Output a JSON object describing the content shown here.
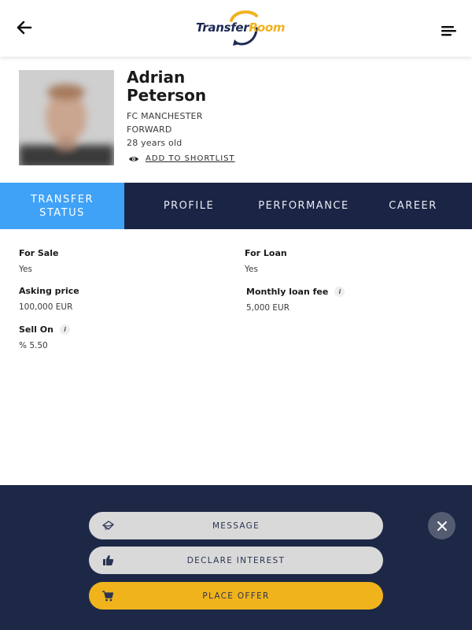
{
  "header": {
    "logo_part1": "Transfer",
    "logo_part2": "Room",
    "icons": {
      "back": "arrow-left-icon",
      "menu": "hamburger-menu-icon"
    }
  },
  "player": {
    "first_name": "Adrian",
    "last_name": "Peterson",
    "club": "FC MANCHESTER",
    "position": "FORWARD",
    "age": "28 years old",
    "shortlist_label": "ADD TO SHORTLIST"
  },
  "tabs": [
    {
      "line1": "TRANSFER",
      "line2": "STATUS",
      "active": true
    },
    {
      "line1": "PROFILE",
      "line2": "",
      "active": false
    },
    {
      "line1": "PERFORMANCE",
      "line2": "",
      "active": false
    },
    {
      "line1": "CAREER",
      "line2": "",
      "active": false
    }
  ],
  "transfer_status": {
    "for_sale": {
      "label": "For Sale",
      "value": "Yes"
    },
    "asking_price": {
      "label": "Asking price",
      "value": "100,000 EUR"
    },
    "sell_on": {
      "label": "Sell On",
      "value": "% 5.50"
    },
    "for_loan": {
      "label": "For Loan",
      "value": "Yes"
    },
    "monthly_loan_fee": {
      "label": "Monthly loan fee",
      "value": "5,000 EUR"
    },
    "info_glyph": "i"
  },
  "actions": {
    "message": "MESSAGE",
    "declare_interest": "DECLARE INTEREST",
    "place_offer": "PLACE OFFER"
  },
  "colors": {
    "navy": "#1a2444",
    "accent_blue": "#3fa2f7",
    "yellow": "#f0b31c",
    "panel": "#1d2846"
  }
}
